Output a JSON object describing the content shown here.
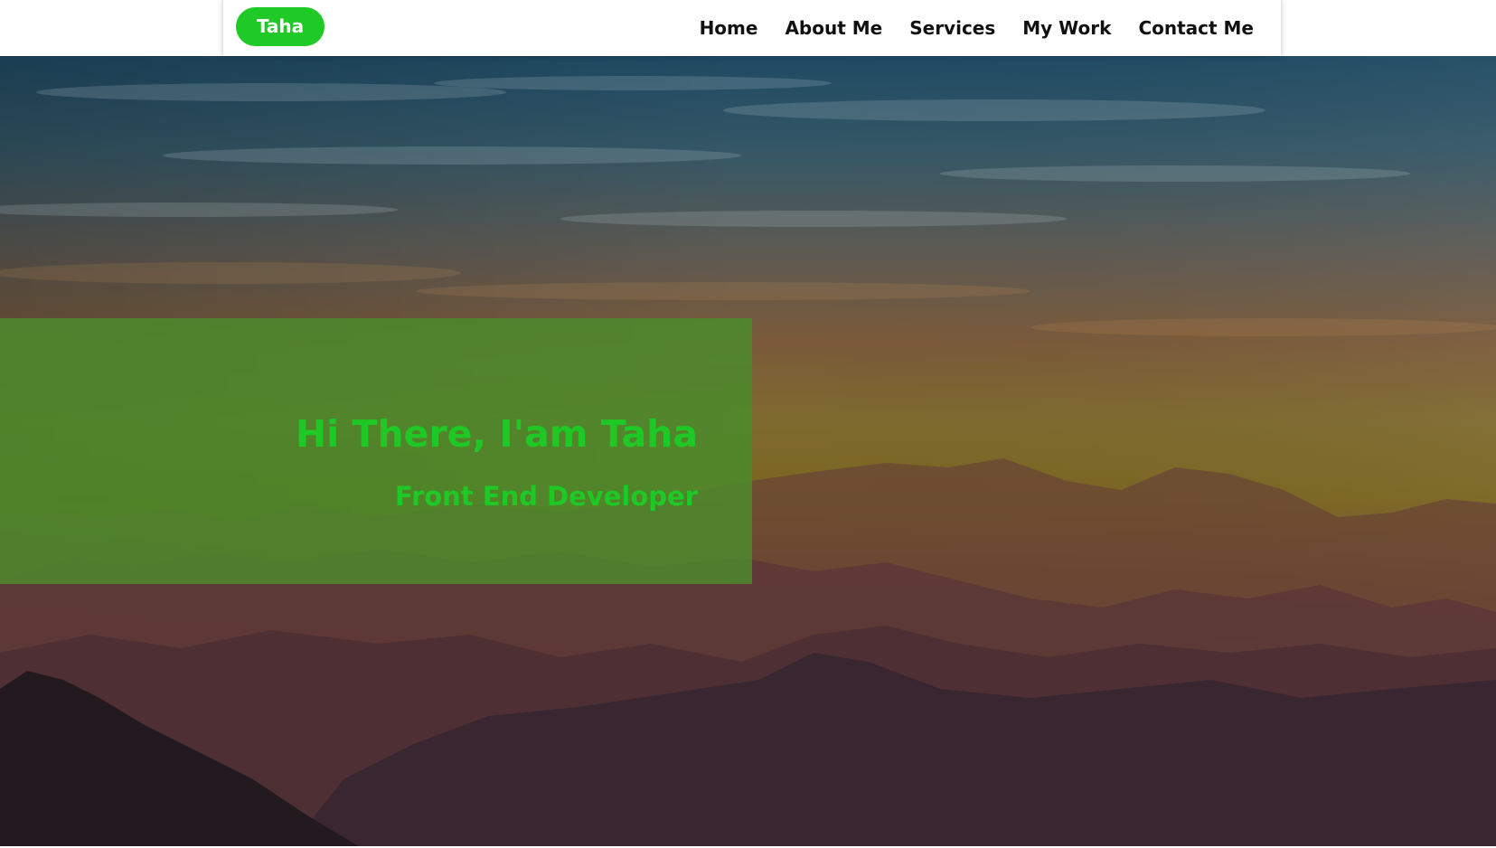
{
  "header": {
    "logo_text": "Taha",
    "nav_items": [
      {
        "label": "Home"
      },
      {
        "label": "About Me"
      },
      {
        "label": "Services"
      },
      {
        "label": "My Work"
      },
      {
        "label": "Contact Me"
      }
    ]
  },
  "hero": {
    "title": "Hi There, I'am Taha",
    "subtitle": "Front End Developer",
    "background_image": "mountain-sunset"
  },
  "colors": {
    "accent_green": "#1fc926",
    "overlay_green": "#4a8c2c",
    "nav_text": "#111111",
    "nav_background": "#ffffff"
  }
}
